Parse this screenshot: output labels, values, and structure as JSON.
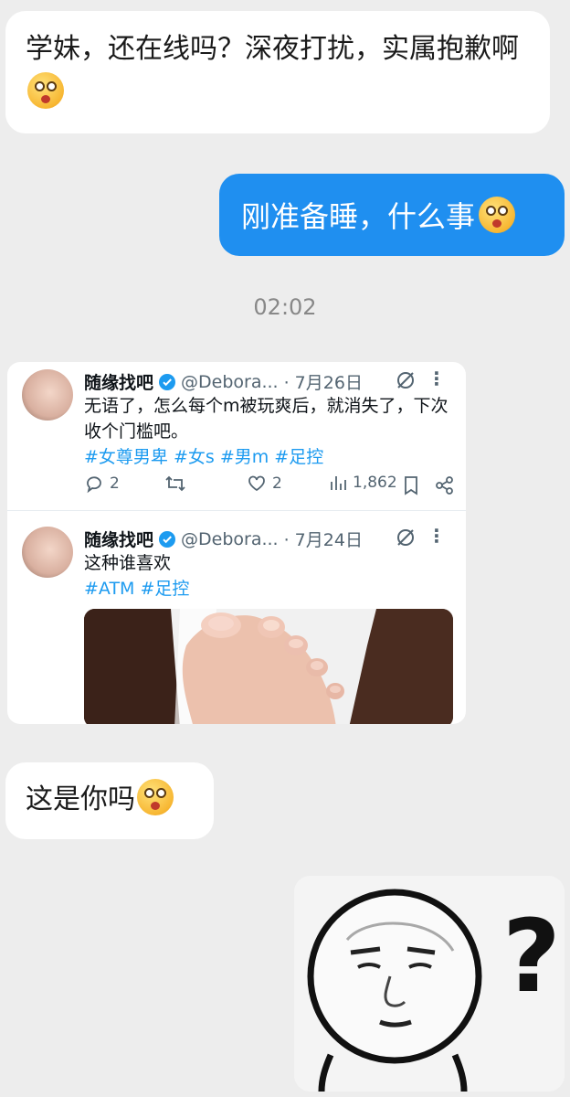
{
  "messages": {
    "msg1": "学妹，还在线吗？深夜打扰，实属抱歉啊",
    "msg2": "刚准备睡，什么事",
    "time": "02:02",
    "msg3": "这是你吗"
  },
  "tweets": [
    {
      "name": "随缘找吧",
      "handle": "@Debora...",
      "date": "· 7月26日",
      "text": "无语了，怎么每个m被玩爽后，就消失了，下次收个门槛吧。",
      "tags": "#女尊男卑 #女s #男m #足控",
      "replies": "2",
      "likes": "2",
      "views": "1,862"
    },
    {
      "name": "随缘找吧",
      "handle": "@Debora...",
      "date": "· 7月24日",
      "text": "这种谁喜欢",
      "tags": "#ATM #足控"
    }
  ],
  "sticker": {
    "mark": "?"
  },
  "colors": {
    "accent": "#1f8ff0",
    "link": "#1d9bf0"
  }
}
